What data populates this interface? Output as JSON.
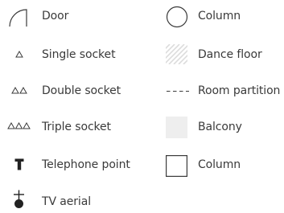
{
  "legend": {
    "left": [
      {
        "label": "Door",
        "icon": "door-swing-icon"
      },
      {
        "label": "Single socket",
        "icon": "single-socket-icon"
      },
      {
        "label": "Double socket",
        "icon": "double-socket-icon"
      },
      {
        "label": "Triple socket",
        "icon": "triple-socket-icon"
      },
      {
        "label": "Telephone point",
        "icon": "telephone-point-icon"
      },
      {
        "label": "TV aerial",
        "icon": "tv-aerial-icon"
      }
    ],
    "right": [
      {
        "label": "Column",
        "icon": "round-column-icon"
      },
      {
        "label": "Dance floor",
        "icon": "dance-floor-hatch-icon"
      },
      {
        "label": "Room partition",
        "icon": "room-partition-icon"
      },
      {
        "label": "Balcony",
        "icon": "balcony-icon"
      },
      {
        "label": "Column",
        "icon": "square-column-icon"
      }
    ]
  },
  "colors": {
    "line": "#3a3a3a",
    "hatch": "#dcdcdc",
    "balcony_fill": "#eeeeee"
  }
}
